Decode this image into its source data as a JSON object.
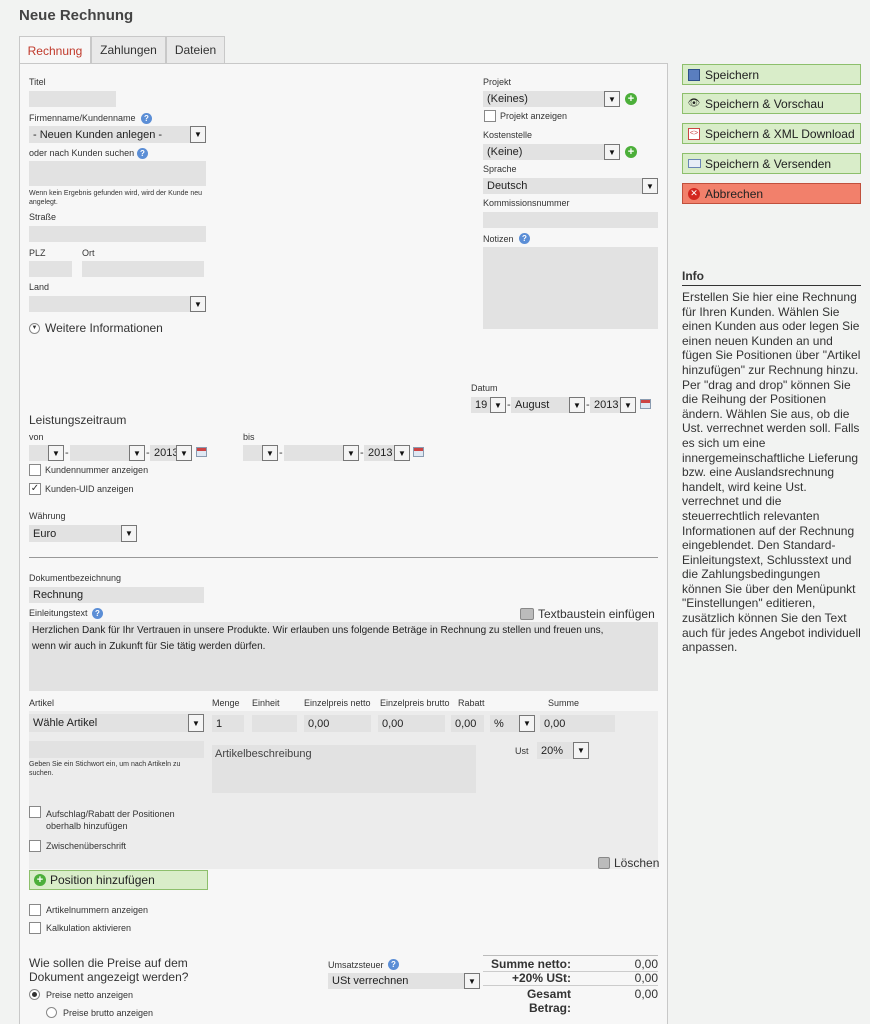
{
  "page": {
    "title": "Neue Rechnung"
  },
  "tabs": [
    "Rechnung",
    "Zahlungen",
    "Dateien"
  ],
  "left": {
    "titel_label": "Titel",
    "firma_label": "Firmenname/Kundenname",
    "firma_select": "- Neuen Kunden anlegen -",
    "search_label": "oder nach Kunden suchen",
    "search_hint": "Wenn kein Ergebnis gefunden wird, wird der Kunde neu angelegt.",
    "strasse_label": "Straße",
    "plz_label": "PLZ",
    "ort_label": "Ort",
    "land_label": "Land",
    "weitere_label": "Weitere Informationen"
  },
  "right": {
    "projekt_label": "Projekt",
    "projekt_value": "(Keines)",
    "projekt_anzeigen": "Projekt anzeigen",
    "kostenstelle_label": "Kostenstelle",
    "kostenstelle_value": "(Keine)",
    "sprache_label": "Sprache",
    "sprache_value": "Deutsch",
    "kommission_label": "Kommissionsnummer",
    "notizen_label": "Notizen"
  },
  "datum": {
    "label": "Datum",
    "day": "19",
    "month": "August",
    "year": "2013"
  },
  "leistung": {
    "title": "Leistungszeitraum",
    "von_label": "von",
    "bis_label": "bis",
    "von_year": "2013",
    "bis_year": "2013",
    "sep": "-",
    "kundennummer": "Kundennummer anzeigen",
    "kunden_uid": "Kunden-UID anzeigen"
  },
  "waehrung": {
    "label": "Währung",
    "value": "Euro"
  },
  "dokument": {
    "bez_label": "Dokumentbezeichnung",
    "bez_value": "Rechnung",
    "einleitung_label": "Einleitungstext",
    "textbaustein": "Textbaustein einfügen",
    "einleitung_text": "Herzlichen Dank für Ihr Vertrauen in unsere Produkte. Wir erlauben uns folgende Beträge in Rechnung zu stellen und freuen uns,\nwenn wir auch in Zukunft für Sie tätig werden dürfen."
  },
  "artikel": {
    "headers": {
      "artikel": "Artikel",
      "menge": "Menge",
      "einheit": "Einheit",
      "netto": "Einzelpreis netto",
      "brutto": "Einzelpreis brutto",
      "rabatt": "Rabatt",
      "summe": "Summe"
    },
    "select": "Wähle Artikel",
    "menge": "1",
    "netto": "0,00",
    "brutto": "0,00",
    "rabatt": "0,00",
    "rabatt_unit": "%",
    "summe": "0,00",
    "beschreibung_placeholder": "Artikelbeschreibung",
    "ust_label": "Ust",
    "ust_value": "20%",
    "stichwort_hint": "Geben Sie ein Stichwort ein, um nach Artikeln zu suchen.",
    "aufschlag": "Aufschlag/Rabatt der Positionen oberhalb hinzufügen",
    "zwischen": "Zwischenüberschrift",
    "loeschen": "Löschen",
    "add_button": "Position hinzufügen",
    "artikelnummern": "Artikelnummern anzeigen",
    "kalkulation": "Kalkulation aktivieren"
  },
  "preise": {
    "question": "Wie sollen die Preise auf dem Dokument angezeigt werden?",
    "netto": "Preise netto anzeigen",
    "brutto": "Preise brutto anzeigen",
    "selected": "netto"
  },
  "steuer": {
    "label": "Umsatzsteuer",
    "value": "USt verrechnen"
  },
  "summen": {
    "netto_label": "Summe netto:",
    "netto_value": "0,00",
    "ust_label": "+20% USt:",
    "ust_value": "0,00",
    "gesamt_label": "Gesamt Betrag:",
    "gesamt_value": "0,00"
  },
  "buttons": {
    "save": "Speichern",
    "save_preview": "Speichern & Vorschau",
    "save_xml": "Speichern & XML Download",
    "save_send": "Speichern & Versenden",
    "cancel": "Abbrechen"
  },
  "info": {
    "title": "Info",
    "text": "Erstellen Sie hier eine Rechnung für Ihren Kunden. Wählen Sie einen Kunden aus oder legen Sie einen neuen Kunden an und fügen Sie Positionen über \"Artikel hinzufügen\" zur Rechnung hinzu. Per \"drag and drop\" können Sie die Reihung der Positionen ändern. Wählen Sie aus, ob die Ust. verrechnet werden soll. Falls es sich um eine innergemeinschaftliche Lieferung bzw. eine Auslandsrechnung handelt, wird keine Ust. verrechnet und die steuerrechtlich relevanten Informationen auf der Rechnung eingeblendet. Den Standard-Einleitungstext, Schlusstext und die Zahlungsbedingungen können Sie über den Menüpunkt \"Einstellungen\" editieren, zusätzlich können Sie den Text auch für jedes Angebot individuell anpassen."
  },
  "colors": {
    "accent_tab": "#c0392b",
    "button_green": "#d9edc9",
    "button_red": "#f2806b"
  },
  "icons": [
    "help-icon",
    "add-icon",
    "calendar-icon",
    "chevron-down-icon",
    "floppy-icon",
    "eye-icon",
    "xml-icon",
    "mail-icon",
    "cancel-icon",
    "textbaustein-icon",
    "delete-icon"
  ]
}
